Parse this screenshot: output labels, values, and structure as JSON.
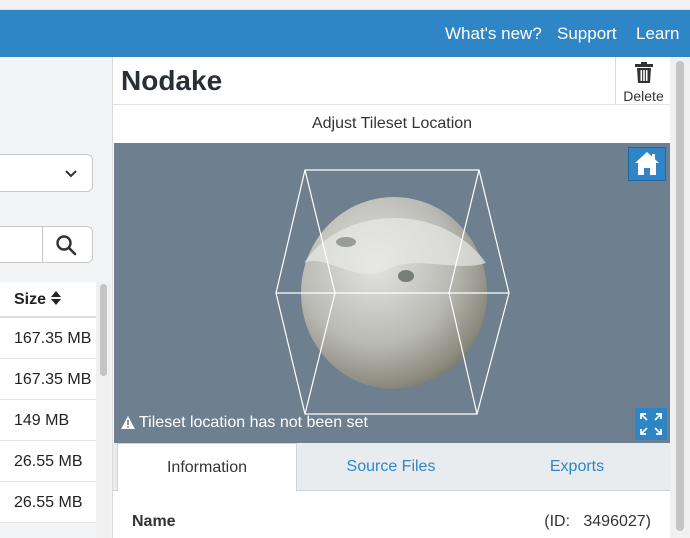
{
  "topbar": {
    "links": [
      "What's new?",
      "Support",
      "Learn"
    ]
  },
  "left": {
    "table": {
      "header": "Size",
      "rows": [
        "167.35 MB",
        "167.35 MB",
        "149 MB",
        "26.55 MB",
        "26.55 MB"
      ]
    }
  },
  "panel": {
    "title": "Nodake",
    "delete_label": "Delete",
    "subtitle": "Adjust Tileset Location",
    "viewer": {
      "warning": "Tileset location has not been set"
    },
    "tabs": [
      "Information",
      "Source Files",
      "Exports"
    ],
    "active_tab": "Information",
    "info": {
      "name_label": "Name",
      "id_text": "(ID:   3496027)"
    }
  },
  "colors": {
    "brand_blue": "#2e86c7",
    "viewer_bg": "#6e7f8f"
  },
  "icons": [
    "chevron-down-icon",
    "search-icon",
    "sort-icon",
    "trash-icon",
    "home-icon",
    "warning-icon",
    "fullscreen-icon"
  ]
}
